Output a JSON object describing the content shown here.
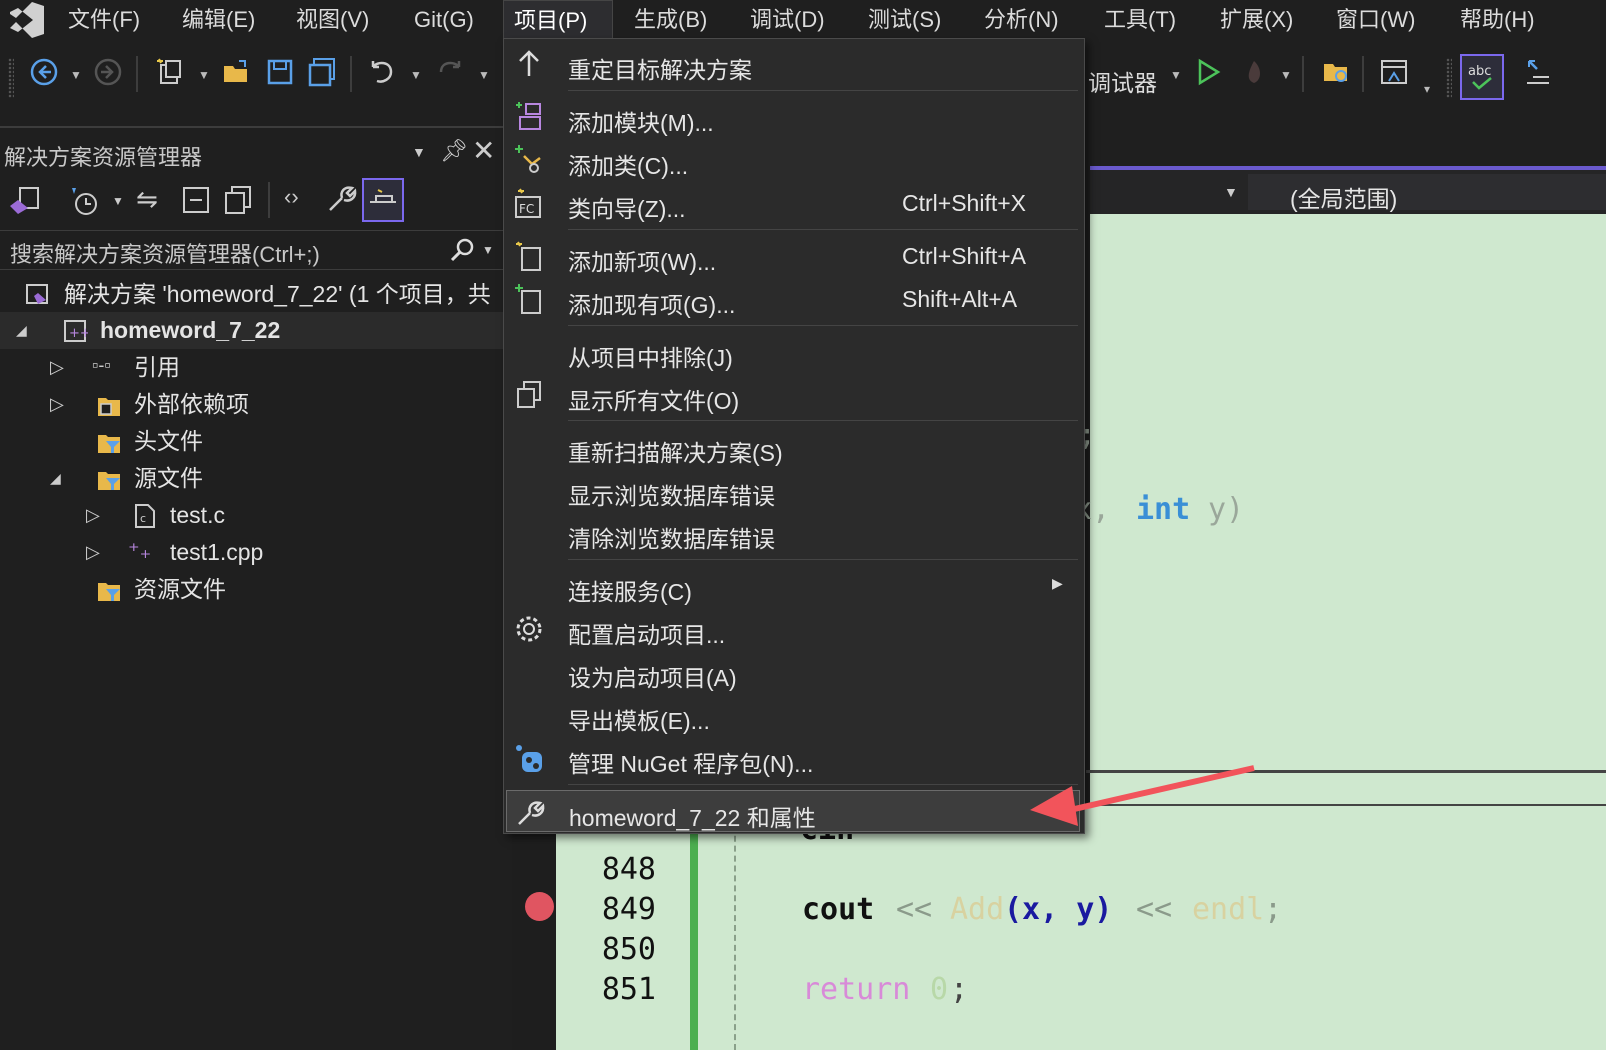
{
  "menubar": {
    "items": [
      "文件(F)",
      "编辑(E)",
      "视图(V)",
      "Git(G)",
      "项目(P)",
      "生成(B)",
      "调试(D)",
      "测试(S)",
      "分析(N)",
      "工具(T)",
      "扩展(X)",
      "窗口(W)",
      "帮助(H)"
    ]
  },
  "toolbar": {
    "debugger_label": "调试器"
  },
  "solution_explorer": {
    "title": "解决方案资源管理器",
    "search_placeholder": "搜索解决方案资源管理器(Ctrl+;)",
    "solution_label": "解决方案 'homeword_7_22' (1 个项目，共",
    "project_label": "homeword_7_22",
    "nodes": [
      "引用",
      "外部依赖项",
      "头文件",
      "源文件",
      "test.c",
      "test1.cpp",
      "资源文件"
    ]
  },
  "editor": {
    "scope": "(全局范围)",
    "partial_code_1": ";",
    "partial_code_2a": "x,",
    "partial_code_2b": "int",
    "partial_code_2c": "y)",
    "partial_code_top": "cin",
    "line_numbers": [
      "848",
      "849",
      "850",
      "851"
    ],
    "line_849": {
      "kw": "cout",
      "op1": "<<",
      "fn": "Add",
      "args": "(x, y)",
      "op2": "<<",
      "endl": "endl",
      "semi": ";"
    },
    "line_851": {
      "kw": "return",
      "num": "0",
      "semi": ";"
    }
  },
  "project_menu": {
    "items": [
      {
        "label": "重定目标解决方案",
        "shortcut": ""
      },
      {
        "label": "添加模块(M)...",
        "shortcut": ""
      },
      {
        "label": "添加类(C)...",
        "shortcut": ""
      },
      {
        "label": "类向导(Z)...",
        "shortcut": "Ctrl+Shift+X"
      },
      {
        "label": "添加新项(W)...",
        "shortcut": "Ctrl+Shift+A"
      },
      {
        "label": "添加现有项(G)...",
        "shortcut": "Shift+Alt+A"
      },
      {
        "label": "从项目中排除(J)",
        "shortcut": ""
      },
      {
        "label": "显示所有文件(O)",
        "shortcut": ""
      },
      {
        "label": "重新扫描解决方案(S)",
        "shortcut": ""
      },
      {
        "label": "显示浏览数据库错误",
        "shortcut": ""
      },
      {
        "label": "清除浏览数据库错误",
        "shortcut": ""
      },
      {
        "label": "连接服务(C)",
        "shortcut": ""
      },
      {
        "label": "配置启动项目...",
        "shortcut": ""
      },
      {
        "label": "设为启动项目(A)",
        "shortcut": ""
      },
      {
        "label": "导出模板(E)...",
        "shortcut": ""
      },
      {
        "label": "管理 NuGet 程序包(N)...",
        "shortcut": ""
      },
      {
        "label": "homeword_7_22 和属性",
        "shortcut": ""
      }
    ]
  },
  "colors": {
    "accent": "#6a5acd",
    "editor_bg": "#cfe8cf",
    "arrow": "#f2545b",
    "breakpoint": "#e05561"
  }
}
